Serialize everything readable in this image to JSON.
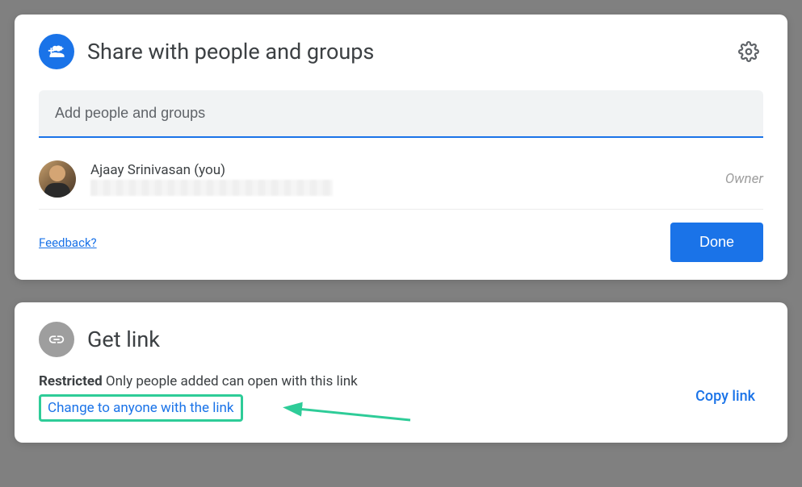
{
  "share": {
    "title": "Share with people and groups",
    "input_placeholder": "Add people and groups",
    "people": [
      {
        "name": "Ajaay Srinivasan (you)",
        "role": "Owner"
      }
    ],
    "feedback_label": "Feedback?",
    "done_label": "Done"
  },
  "getlink": {
    "title": "Get link",
    "restriction_label": "Restricted",
    "restriction_desc": " Only people added can open with this link",
    "change_label": "Change to anyone with the link",
    "copy_label": "Copy link"
  }
}
